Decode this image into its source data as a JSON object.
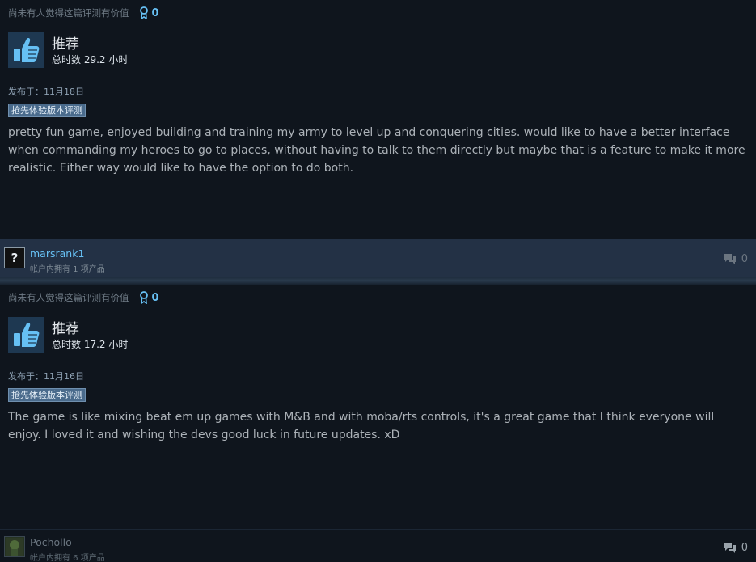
{
  "reviews": [
    {
      "helpful_text": "尚未有人觉得这篇评测有价值",
      "award_count": "0",
      "recommendation": "推荐",
      "hours": "总时数 29.2 小时",
      "posted": "发布于：11月18日",
      "badge": "抢先体验版本评测",
      "body": "pretty fun game, enjoyed building and training my army to level up and conquering cities. would like to have a better interface when commanding my heroes to go to places, without having to talk to them directly but maybe that is a feature to make it more realistic. Either way would like to have the option to do both.",
      "author": {
        "avatar_glyph": "?",
        "name": "marsrank1",
        "owns": "帐户内拥有 1 项产品"
      },
      "comment_count": "0"
    },
    {
      "helpful_text": "尚未有人觉得这篇评测有价值",
      "award_count": "0",
      "recommendation": "推荐",
      "hours": "总时数 17.2 小时",
      "posted": "发布于：11月16日",
      "badge": "抢先体验版本评测",
      "body": "The game is like mixing beat em up games with M&B and with moba/rts controls, it's a great game that I think everyone will enjoy. I loved it and wishing the devs good luck in future updates. xD",
      "author": {
        "name": "Pochollo",
        "owns": "帐户内拥有 6 项产品"
      },
      "comment_count": "0"
    }
  ],
  "icons": {
    "award": "award-ribbon-icon",
    "thumb": "thumbs-up-icon",
    "comment": "speech-bubble-icon"
  },
  "colors": {
    "accent": "#67c1f5",
    "background": "#0f151d",
    "author_bar": "#233145"
  }
}
